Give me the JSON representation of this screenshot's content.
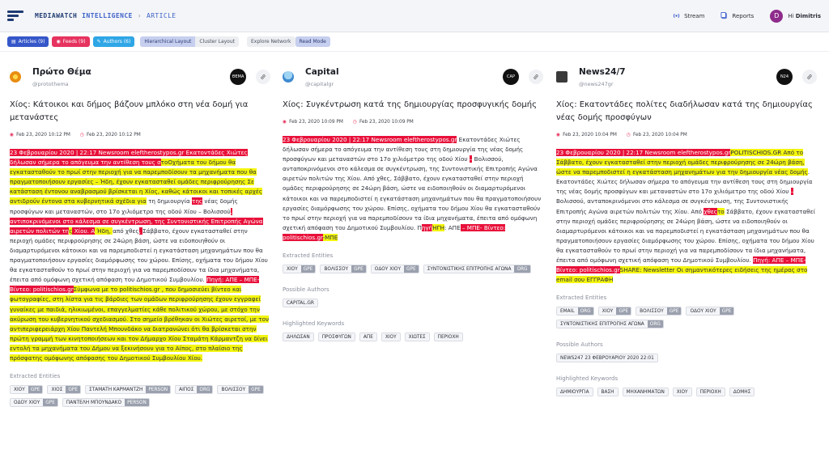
{
  "header": {
    "brand": "MEDIAWATCH",
    "brand_accent": "INTELLIGENCE",
    "separator": "›",
    "page": "ARTICLE",
    "stream_label": "Stream",
    "reports_label": "Reports",
    "avatar_letter": "D",
    "greeting": "Hi",
    "user_name": "Dimitris"
  },
  "toolbar": {
    "articles": "Articles (9)",
    "feeds": "Feeds (9)",
    "authors": "Authors (6)",
    "hierarchical": "Hierarchical Layout",
    "cluster": "Cluster Layout",
    "explore": "Explore Network",
    "read": "Read Mode"
  },
  "columns": [
    {
      "source": "Πρώτο Θέμα",
      "handle": "@protothema",
      "badge": "ΘΕΜΑ",
      "title": "Χίος: Κάτοικοι και δήμος βάζουν μπλόκο στη νέα δομή για μετανάστες",
      "date_published": "Feb 23, 2020 10:12 PM",
      "date_updated": "Feb 23, 2020 10:12 PM",
      "body": [
        {
          "t": "23 Φεβρουαρίου 2020 | 22:17 Newsroom eleftherostypos.gr Εκατοντάδες Χιώτες δήλωσαν σήμερα το απόγευμα την αντίθεση τους σ",
          "h": "r"
        },
        {
          "t": "τοΟχήματα του δήμου θα εγκατασταθούν το πρωί στην περιοχή για να παρεμποδίσουν τα μηχανήματα που θα πραγματοποιήσουν εργασίες – Ήδη, έχουν εγκατασταθεί ομάδες περιφρούρησης Σε κατάσταση έντονου αναβρασμού βρίσκεται η Χίος, καθώς κάτοικοι και τοπικές αρχές αντιδρούν έντονα στα κυβερνητικά σχέδια για",
          "h": "y"
        },
        {
          "t": " τη δημιουργία ",
          "h": ""
        },
        {
          "t": "της",
          "h": "r"
        },
        {
          "t": " νέας δομής προσφύγων και μεταναστών, στο 17ο χιλιόμετρο της οδού Χίου – Βολισσού",
          "h": ""
        },
        {
          "t": ", αντιποκρινόμενοι στο κάλεσμα σε συγκέντρωση, της Συντονιστικής Επιτροπής Αγώνα αιρετών πολιτών τη",
          "h": "r"
        },
        {
          "t": "ς",
          "h": "y"
        },
        {
          "t": " Χίου. Α",
          "h": "r"
        },
        {
          "t": " Ήδη, ",
          "h": "y"
        },
        {
          "t": "από χθες",
          "h": ""
        },
        {
          "t": ", ",
          "h": "r"
        },
        {
          "t": " Σάββατο, έχουν εγκατασταθεί στην περιοχή ομάδες περιφρούρησης σε 24ώρη βάση, ώστε να ειδοποιηθούν οι διαμαρτυρόμενοι κάτοικοι και να παρεμποδιστεί η εγκατάσταση μηχανημάτων που θα πραγματοποιήσουν εργασίες διαμόρφωσης του χώρου. Επίσης, οχήματα του δήμου Χίου θα εγκατασταθούν το πρωί στην περιοχή για να παρεμποδίσουν τα ίδια μηχανήματα, έπειτα από ομόφωνη σχετική απόφαση του Δημοτικού Συμβουλίου. ",
          "h": ""
        },
        {
          "t": "Πηγή: ΑΠΕ – ΜΠΕ- Βίντεο: politischios.gr",
          "h": "r"
        },
        {
          "t": "Σύμφωνα με το politischios.gr , που δημοσιεύει βίντεο και φωτογραφίες, στη λίστα για τις βάρδιες των ομάδων περιφρούρησης έχουν εγγραφεί γυναίκες με παιδιά, ηλικιωμένοι, επαγγελματίες κάθε πολιτικού χώρου, με στόχο την ακύρωση του κυβερνητικού σχεδιασμού. Στο σημείο βρέθηκαν οι Χιώτες αιρετοί, με τον αντιπεριφερειάρχη Χίου Παντελή Μπουνδάκο να διατρανώνει ότι θα βρίσκεται στην πρώτη γραμμή των κινητοποιήσεων και τον Δήμαρχο Χίου Σταμάτη Κάρμαντζη να δίνει εντολή τα μηχανήματα του Δήμου να ξεκινήσουν για το Αίπος, στο πλαίσιο της πρόσφατης ομόφωνης απόφασης του Δημοτικού Συμβουλίου Χίου.",
          "h": "y"
        }
      ],
      "entities_label": "Extracted Entities",
      "entities": [
        {
          "name": "ΧΙΟΥ",
          "kind": "GPE"
        },
        {
          "name": "ΧΙΟΣ",
          "kind": "GPE"
        },
        {
          "name": "ΣΤΑΜΑΤΗ ΚΑΡΜΑΝΤΖΗ",
          "kind": "PERSON"
        },
        {
          "name": "ΑΙΠΟΣ",
          "kind": "ORG"
        },
        {
          "name": "ΒΟΛΙΣΣΟΥ",
          "kind": "GPE"
        },
        {
          "name": "ΟΔΟΥ ΧΙΟΥ",
          "kind": "GPE"
        },
        {
          "name": "ΠΑΝΤΕΛΗ ΜΠΟΥΝΔΑΚΟ",
          "kind": "PERSON"
        }
      ]
    },
    {
      "source": "Capital",
      "handle": "@capitalgr",
      "badge": "CAP",
      "title": "Χίος: Συγκέντρωση κατά της δημιουργίας προσφυγικής δομής",
      "date_published": "Feb 23, 2020 10:09 PM",
      "date_updated": "Feb 23, 2020 10:09 PM",
      "body": [
        {
          "t": "23 Φεβρουαρίου 2020 | 22:17 Newsroom eleftherostypos.gr",
          "h": "r"
        },
        {
          "t": " Εκατοντάδες Χιώτες δήλωσαν σήμερα το απόγευμα την αντίθεση τους στη δημιουργία της νέας δομής προσφύγων και μεταναστών στο 17ο χιλιόμετρο της οδού Χίου ",
          "h": ""
        },
        {
          "t": "–",
          "h": "r"
        },
        {
          "t": " Βολισσού, ανταποκρινόμενοι στο κάλεσμα σε συγκέντρωση, της Συντονιστικής Επιτροπής Αγώνα αιρετών πολιτών της Χίου. Από χθες, Σάββατο, έχουν εγκατασταθεί στην περιοχή ομάδες περιφρούρησης σε 24ώρη βάση, ώστε να ειδοποιηθούν οι διαμαρτυρόμενοι κάτοικοι και να παρεμποδιστεί η εγκατάσταση μηχανημάτων που θα πραγματοποιήσουν εργασίες διαμόρφωσης του χώρου. Επίσης, οχήματα του δήμου Χίου θα εγκατασταθούν το πρωί στην περιοχή για να παρεμποδίσουν τα ίδια μηχανήματα, έπειτα από ομόφωνη σχετική απόφαση του Δημοτικού Συμβουλίου. Π",
          "h": ""
        },
        {
          "t": "ηγή",
          "h": "r"
        },
        {
          "t": "ΗΓΗ",
          "h": "y"
        },
        {
          "t": ": ΑΠΕ",
          "h": ""
        },
        {
          "t": " – ΜΠΕ- Βίντεο: politischios.gr",
          "h": "r"
        },
        {
          "t": "-ΜΠΕ",
          "h": "y"
        }
      ],
      "entities_label": "Extracted Entities",
      "entities": [
        {
          "name": "ΧΙΟΥ",
          "kind": "GPE"
        },
        {
          "name": "ΒΟΛΙΣΣΟΥ",
          "kind": "GPE"
        },
        {
          "name": "ΟΔΟΥ ΧΙΟΥ",
          "kind": "GPE"
        },
        {
          "name": "ΣΥΝΤΟΝΙΣΤΙΚΗΣ ΕΠΙΤΡΟΠΗΣ ΑΓΩΝΑ",
          "kind": "ORG"
        }
      ],
      "authors_label": "Possible Authors",
      "authors": [
        "CAPITAL.GR"
      ],
      "keywords_label": "Highlighted Keywords",
      "keywords": [
        "ΔΗΛΩΣΑΝ",
        "ΠΡΟΣΦΥΓΩΝ",
        "ΑΠΕ",
        "ΧΙΟΥ",
        "ΧΙΩΤΕΣ",
        "ΠΕΡΙΟΧΗ"
      ]
    },
    {
      "source": "News24/7",
      "handle": "@news247gr",
      "badge": "N24",
      "title": "Χίος: Εκατοντάδες πολίτες διαδήλωσαν κατά της δημιουργίας νέας δομής προσφύγων",
      "date_published": "Feb 23, 2020 10:04 PM",
      "date_updated": "Feb 23, 2020 10:04 PM",
      "body": [
        {
          "t": "23 Φεβρουαρίου 2020 | 22:17 Newsroom eleftherostypos.gr",
          "h": "r"
        },
        {
          "t": "POLITISCHIOS.GR Από το Σάββατο, έχουν εγκατασταθεί στην περιοχή ομάδες περιφρούρησης σε 24ώρη βάση, ώστε να παρεμποδιστεί η εγκατάσταση μηχανημάτων για την δημιουργία νέας δομής",
          "h": "y"
        },
        {
          "t": ". Εκατοντάδες Χιώτες δήλωσαν σήμερα το απόγευμα την αντίθεση τους στη δημιουργία της νέας δομής προσφύγων και μεταναστών στο 17ο χιλιόμετρο της οδού Χίου ",
          "h": ""
        },
        {
          "t": "–",
          "h": "r"
        },
        {
          "t": " Βολισσού, ανταποκρινόμενοι στο κάλεσμα σε συγκέντρωση, της Συντονιστικής Επιτροπής Αγώνα αιρετών πολιτών της Χίου. Από ",
          "h": ""
        },
        {
          "t": "χθες",
          "h": "r"
        },
        {
          "t": "το",
          "h": "y"
        },
        {
          "t": " Σάββατο, έχουν εγκατασταθεί στην περιοχή ομάδες περιφρούρησης σε 24ώρη βάση, ώστε να ειδοποιηθούν οι διαμαρτυρόμενοι κάτοικοι και να παρεμποδιστεί η εγκατάσταση μηχανημάτων που θα πραγματοποιήσουν εργασίες διαμόρφωσης του χώρου. Επίσης, οχήματα του δήμου Χίου θα εγκατασταθούν το πρωί στην περιοχή για να παρεμποδίσουν τα ίδια μηχανήματα, έπειτα από ομόφωνη σχετική απόφαση του Δημοτικού Συμβουλίου. ",
          "h": ""
        },
        {
          "t": "Πηγή: ΑΠΕ – ΜΠΕ- Βίντεο: politischios.gr",
          "h": "r"
        },
        {
          "t": "SHARE: Newsletter Οι σημαντικότερες ειδήσεις της ημέρας στο email σου ΕΓΓΡΑΦΗ",
          "h": "y"
        }
      ],
      "entities_label": "Extracted Entities",
      "entities": [
        {
          "name": "EMAIL",
          "kind": "ORG"
        },
        {
          "name": "ΧΙΟΥ",
          "kind": "GPE"
        },
        {
          "name": "ΒΟΛΙΣΣΟΥ",
          "kind": "GPE"
        },
        {
          "name": "ΟΔΟΥ ΧΙΟΥ",
          "kind": "GPE"
        },
        {
          "name": "ΣΥΝΤΟΝΙΣΤΙΚΗΣ ΕΠΙΤΡΟΠΗΣ ΑΓΩΝΑ",
          "kind": "ORG"
        }
      ],
      "authors_label": "Possible Authors",
      "authors": [
        "NEWS247 23 ΦΕΒΡΟΥΑΡΙΟΥ 2020 22:01"
      ],
      "keywords_label": "Highlighted Keywords",
      "keywords": [
        "ΔΗΜΙΟΥΡΓΙΑ",
        "ΒΑΣΗ",
        "ΜΗΧΑΝΗΜΑΤΩΝ",
        "ΧΙΟΥ",
        "ΠΕΡΙΟΧΗ",
        "ΔΟΜΗΣ"
      ]
    }
  ],
  "colors": {
    "highlight_red": "#e8103a",
    "highlight_yellow": "#f3f50f",
    "accent_blue": "#3557c9",
    "feeds_pink": "#e6335f",
    "authors_cyan": "#2fa6e6"
  }
}
